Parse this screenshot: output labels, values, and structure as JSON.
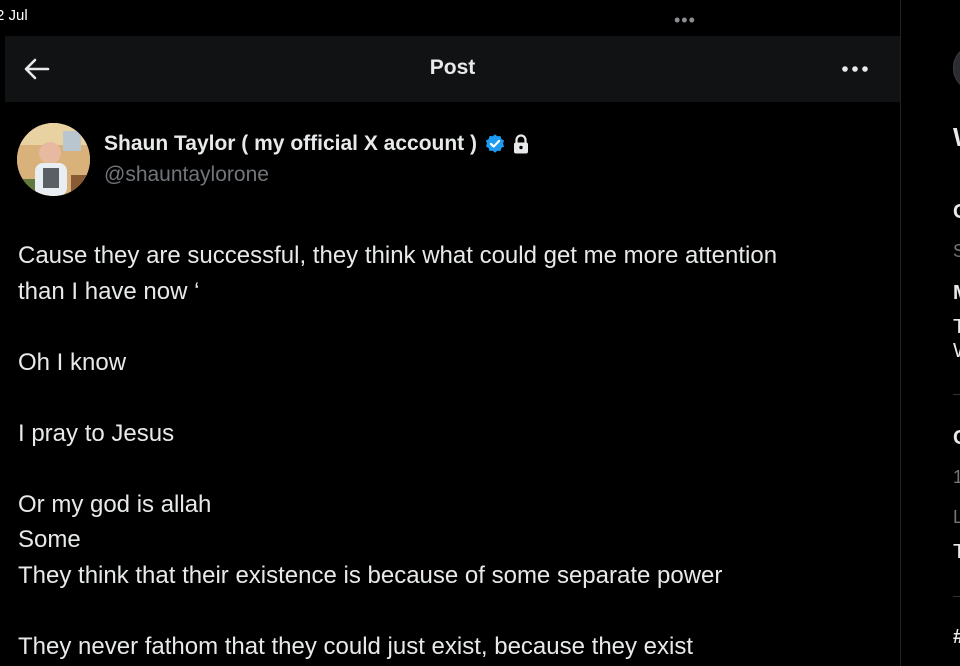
{
  "status_bar": {
    "date": "2 Jul",
    "multitask": "•••"
  },
  "header": {
    "title": "Post"
  },
  "author": {
    "display_name": "Shaun Taylor ( my official X account )",
    "handle": "@shauntaylorone",
    "verified": true,
    "protected": true
  },
  "post": {
    "lines": [
      "Cause they are successful, they think what could get me more attention",
      "than I have now ‘",
      "",
      "Oh I know",
      "",
      "I pray to Jesus",
      "",
      "Or my god is allah",
      "Some",
      "They think that their existence is because of some separate power",
      "",
      "They never fathom that they could just exist, because they exist"
    ]
  },
  "right_sidebar": {
    "fragments": [
      "W",
      "C",
      "S",
      "M",
      "T",
      "W",
      "C",
      "1",
      "L",
      "T",
      "#"
    ]
  },
  "colors": {
    "background": "#000000",
    "text": "#e7e9ea",
    "secondary": "#71767b",
    "verified": "#1d9bf0",
    "header_bg": "#111214"
  }
}
